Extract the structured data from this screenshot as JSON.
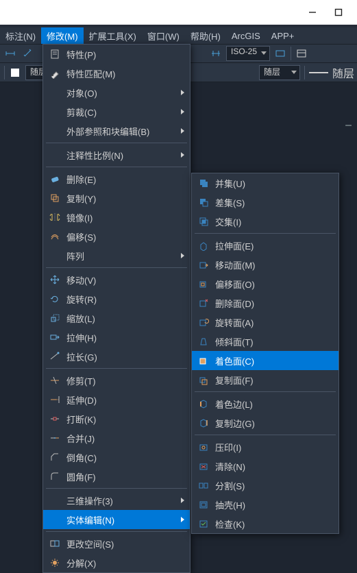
{
  "menubar": {
    "items": [
      {
        "label": "标注(N)"
      },
      {
        "label": "修改(M)"
      },
      {
        "label": "扩展工具(X)"
      },
      {
        "label": "窗口(W)"
      },
      {
        "label": "帮助(H)"
      },
      {
        "label": "ArcGIS"
      },
      {
        "label": "APP+"
      }
    ]
  },
  "toolbar": {
    "dim_style": "ISO-25",
    "layer_current": "随层",
    "layer_right_1": "随层",
    "layer_right_2": "随层"
  },
  "modify_menu": {
    "properties": "特性(P)",
    "match_props": "特性匹配(M)",
    "object": "对象(O)",
    "clip": "剪裁(C)",
    "xref_block": "外部参照和块编辑(B)",
    "anno_scale": "注释性比例(N)",
    "delete": "删除(E)",
    "copy": "复制(Y)",
    "mirror": "镜像(I)",
    "offset": "偏移(S)",
    "array": "阵列",
    "move": "移动(V)",
    "rotate": "旋转(R)",
    "scale": "缩放(L)",
    "stretch": "拉伸(H)",
    "lengthen": "拉长(G)",
    "trim": "修剪(T)",
    "extend": "延伸(D)",
    "break": "打断(K)",
    "join": "合并(J)",
    "chamfer": "倒角(C)",
    "fillet": "圆角(F)",
    "ops_3d": "三维操作(3)",
    "solid_edit": "实体编辑(N)",
    "change_space": "更改空间(S)",
    "explode": "分解(X)"
  },
  "solidedit_sub": {
    "union": "并集(U)",
    "subtract": "差集(S)",
    "intersect": "交集(I)",
    "extrude_face": "拉伸面(E)",
    "move_face": "移动面(M)",
    "offset_face": "偏移面(O)",
    "delete_face": "删除面(D)",
    "rotate_face": "旋转面(A)",
    "taper_face": "倾斜面(T)",
    "color_face": "着色面(C)",
    "copy_face": "复制面(F)",
    "color_edge": "着色边(L)",
    "copy_edge": "复制边(G)",
    "imprint": "压印(I)",
    "clean": "清除(N)",
    "separate": "分割(S)",
    "shell": "抽壳(H)",
    "check": "检查(K)"
  },
  "colors": {
    "highlight": "#0078d7",
    "panel": "#2c3542",
    "border": "#4a5566"
  }
}
